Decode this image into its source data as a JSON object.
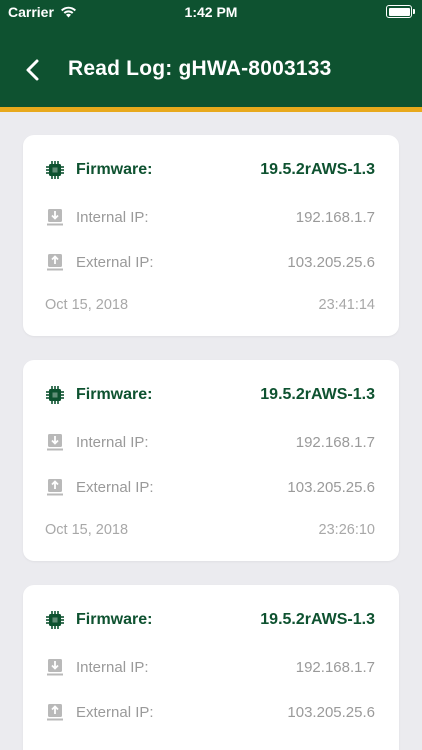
{
  "status_bar": {
    "carrier": "Carrier",
    "time": "1:42 PM"
  },
  "nav": {
    "title": "Read Log: gHWA-8003133"
  },
  "colors": {
    "header": "#0e5230",
    "accent": "#e8a91c",
    "muted": "#9a9a9a"
  },
  "entries": [
    {
      "firmware_label": "Firmware:",
      "firmware": "19.5.2rAWS-1.3",
      "internal_label": "Internal IP:",
      "internal_ip": "192.168.1.7",
      "external_label": "External IP:",
      "external_ip": "103.205.25.6",
      "date": "Oct 15, 2018",
      "time": "23:41:14"
    },
    {
      "firmware_label": "Firmware:",
      "firmware": "19.5.2rAWS-1.3",
      "internal_label": "Internal IP:",
      "internal_ip": "192.168.1.7",
      "external_label": "External IP:",
      "external_ip": "103.205.25.6",
      "date": "Oct 15, 2018",
      "time": "23:26:10"
    },
    {
      "firmware_label": "Firmware:",
      "firmware": "19.5.2rAWS-1.3",
      "internal_label": "Internal IP:",
      "internal_ip": "192.168.1.7",
      "external_label": "External IP:",
      "external_ip": "103.205.25.6",
      "date": "",
      "time": ""
    }
  ]
}
